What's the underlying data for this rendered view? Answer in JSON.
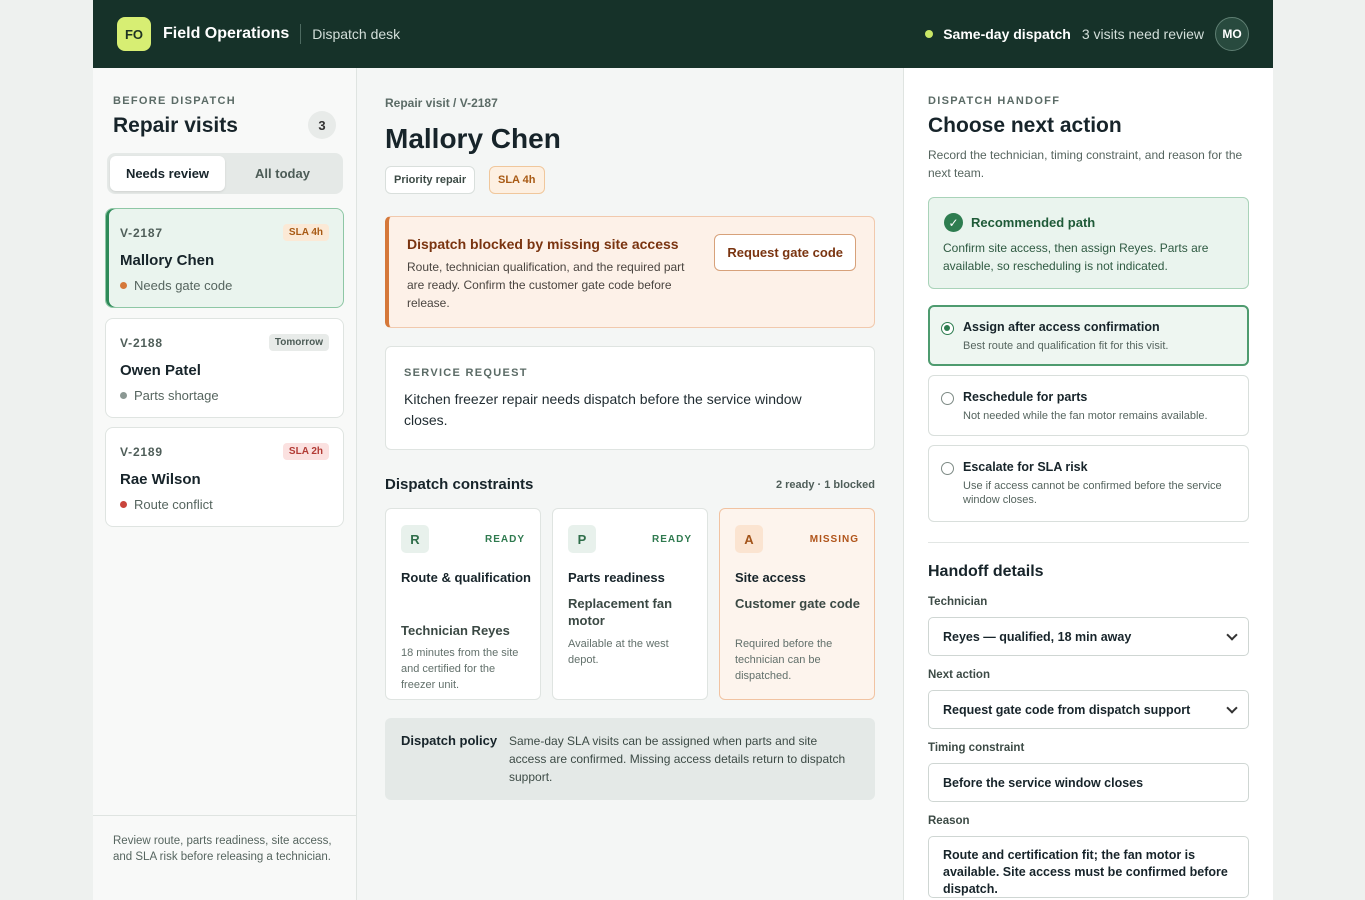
{
  "header": {
    "logo": "FO",
    "app_name": "Field Operations",
    "subtitle": "Dispatch desk",
    "status": "Same-day dispatch",
    "review": "3 visits need review",
    "avatar": "MO"
  },
  "sidebar": {
    "eyebrow": "BEFORE DISPATCH",
    "title": "Repair visits",
    "count": "3",
    "tabs": [
      "Needs review",
      "All today"
    ],
    "visits": [
      {
        "id": "V-2187",
        "badge": "SLA 4h",
        "name": "Mallory Chen",
        "status": "Needs gate code"
      },
      {
        "id": "V-2188",
        "badge": "Tomorrow",
        "name": "Owen Patel",
        "status": "Parts shortage"
      },
      {
        "id": "V-2189",
        "badge": "SLA 2h",
        "name": "Rae Wilson",
        "status": "Route conflict"
      }
    ],
    "footer": "Review route, parts readiness, site access, and SLA risk before releasing a technician."
  },
  "main": {
    "breadcrumb_parent": "Repair visit",
    "breadcrumb_sep": "/",
    "breadcrumb_current": "V-2187",
    "title": "Mallory Chen",
    "tags": [
      "Priority repair",
      "SLA 4h"
    ],
    "alert": {
      "title": "Dispatch blocked by missing site access",
      "body": "Route, technician qualification, and the required part are ready. Confirm the customer gate code before release.",
      "button": "Request gate code"
    },
    "service": {
      "eyebrow": "SERVICE REQUEST",
      "text": "Kitchen freezer repair needs dispatch before the service window closes."
    },
    "constraints_title": "Dispatch constraints",
    "constraints_meta": "2 ready · 1 blocked",
    "constraints": [
      {
        "letter": "R",
        "state": "READY",
        "title": "Route & qualification",
        "sub": "Technician Reyes",
        "desc": "18 minutes from the site and certified for the freezer unit."
      },
      {
        "letter": "P",
        "state": "READY",
        "title": "Parts readiness",
        "sub": "Replacement fan motor",
        "desc": "Available at the west depot."
      },
      {
        "letter": "A",
        "state": "MISSING",
        "title": "Site access",
        "sub": "Customer gate code",
        "desc": "Required before the technician can be dispatched."
      }
    ],
    "policy": {
      "label": "Dispatch policy",
      "text": "Same-day SLA visits can be assigned when parts and site access are confirmed. Missing access details return to dispatch support."
    }
  },
  "handoff": {
    "eyebrow": "DISPATCH HANDOFF",
    "title": "Choose next action",
    "desc": "Record the technician, timing constraint, and reason for the next team.",
    "recommended": {
      "title": "Recommended path",
      "text": "Confirm site access, then assign Reyes. Parts are available, so rescheduling is not indicated."
    },
    "options": [
      {
        "title": "Assign after access confirmation",
        "desc": "Best route and qualification fit for this visit."
      },
      {
        "title": "Reschedule for parts",
        "desc": "Not needed while the fan motor remains available."
      },
      {
        "title": "Escalate for SLA risk",
        "desc": "Use if access cannot be confirmed before the service window closes."
      }
    ],
    "details_title": "Handoff details",
    "technician_label": "Technician",
    "technician_value": "Reyes — qualified, 18 min away",
    "next_action_label": "Next action",
    "next_action_value": "Request gate code from dispatch support",
    "timing_label": "Timing constraint",
    "timing_value": "Before the service window closes",
    "reason_label": "Reason",
    "reason_value": "Route and certification fit; the fan motor is available. Site access must be confirmed before dispatch."
  }
}
